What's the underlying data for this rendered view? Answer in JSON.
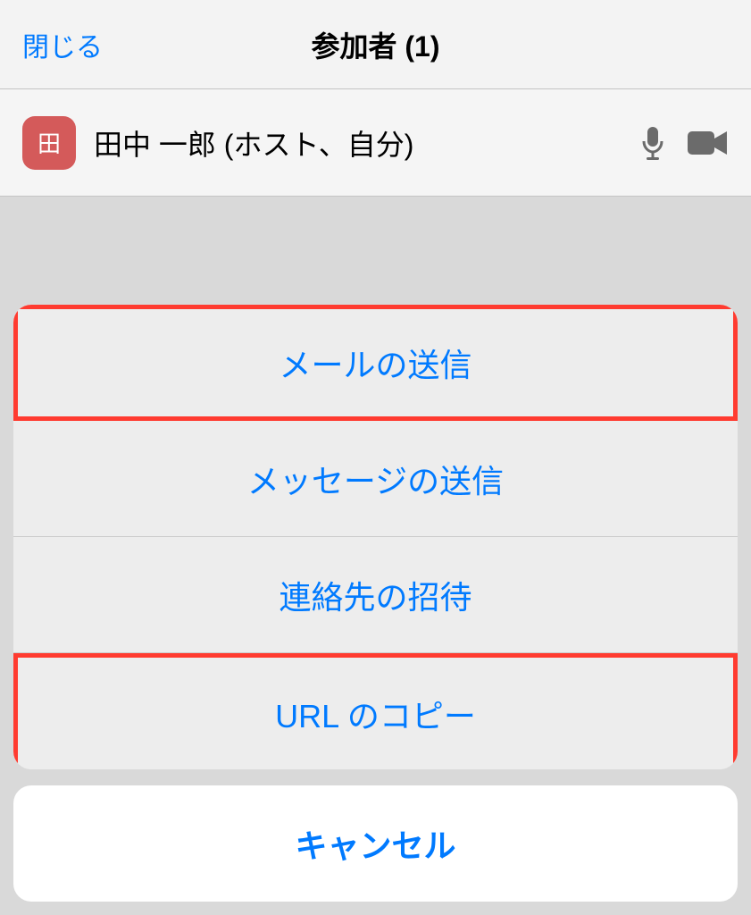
{
  "header": {
    "close_label": "閉じる",
    "title": "参加者 (1)"
  },
  "participant": {
    "avatar_text": "田",
    "name": "田中 一郎 (ホスト、自分)"
  },
  "sheet": {
    "options": [
      {
        "label": "メールの送信",
        "highlighted": true
      },
      {
        "label": "メッセージの送信",
        "highlighted": false
      },
      {
        "label": "連絡先の招待",
        "highlighted": false
      },
      {
        "label": "URL のコピー",
        "highlighted": true
      }
    ],
    "cancel_label": "キャンセル"
  }
}
